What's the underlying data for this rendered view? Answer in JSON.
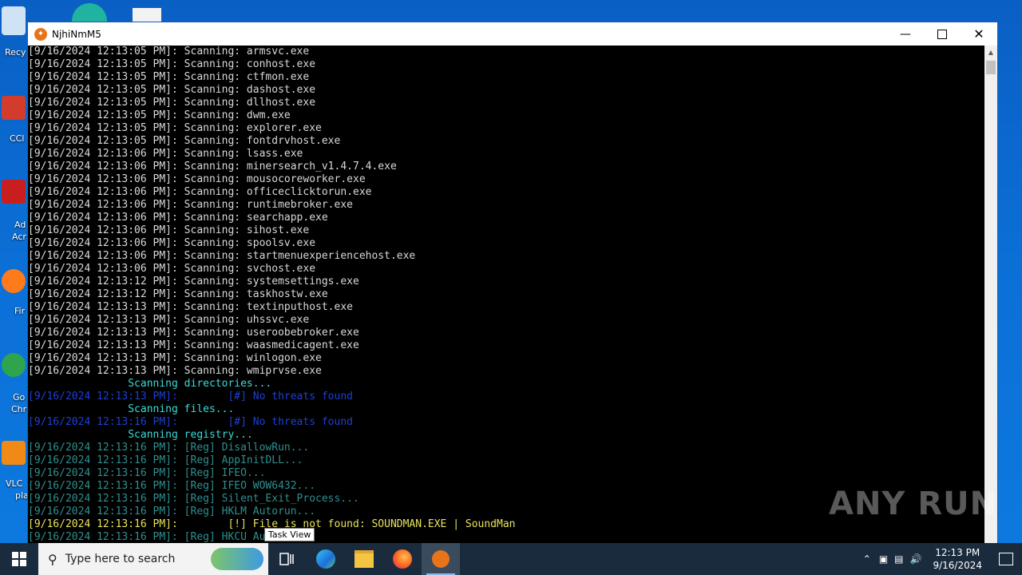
{
  "window": {
    "title": "NjhiNmM5"
  },
  "desktop": {
    "labels": [
      "Recy",
      "CCl",
      "Ad",
      "Acr",
      "Fir",
      "Go",
      "Chr",
      "VLC",
      "pla"
    ]
  },
  "console_lines": [
    {
      "color": "white",
      "text": "[9/16/2024 12:13:05 PM]: Scanning: armsvc.exe"
    },
    {
      "color": "white",
      "text": "[9/16/2024 12:13:05 PM]: Scanning: conhost.exe"
    },
    {
      "color": "white",
      "text": "[9/16/2024 12:13:05 PM]: Scanning: ctfmon.exe"
    },
    {
      "color": "white",
      "text": "[9/16/2024 12:13:05 PM]: Scanning: dashost.exe"
    },
    {
      "color": "white",
      "text": "[9/16/2024 12:13:05 PM]: Scanning: dllhost.exe"
    },
    {
      "color": "white",
      "text": "[9/16/2024 12:13:05 PM]: Scanning: dwm.exe"
    },
    {
      "color": "white",
      "text": "[9/16/2024 12:13:05 PM]: Scanning: explorer.exe"
    },
    {
      "color": "white",
      "text": "[9/16/2024 12:13:05 PM]: Scanning: fontdrvhost.exe"
    },
    {
      "color": "white",
      "text": "[9/16/2024 12:13:06 PM]: Scanning: lsass.exe"
    },
    {
      "color": "white",
      "text": "[9/16/2024 12:13:06 PM]: Scanning: minersearch_v1.4.7.4.exe"
    },
    {
      "color": "white",
      "text": "[9/16/2024 12:13:06 PM]: Scanning: mousocoreworker.exe"
    },
    {
      "color": "white",
      "text": "[9/16/2024 12:13:06 PM]: Scanning: officeclicktorun.exe"
    },
    {
      "color": "white",
      "text": "[9/16/2024 12:13:06 PM]: Scanning: runtimebroker.exe"
    },
    {
      "color": "white",
      "text": "[9/16/2024 12:13:06 PM]: Scanning: searchapp.exe"
    },
    {
      "color": "white",
      "text": "[9/16/2024 12:13:06 PM]: Scanning: sihost.exe"
    },
    {
      "color": "white",
      "text": "[9/16/2024 12:13:06 PM]: Scanning: spoolsv.exe"
    },
    {
      "color": "white",
      "text": "[9/16/2024 12:13:06 PM]: Scanning: startmenuexperiencehost.exe"
    },
    {
      "color": "white",
      "text": "[9/16/2024 12:13:06 PM]: Scanning: svchost.exe"
    },
    {
      "color": "white",
      "text": "[9/16/2024 12:13:12 PM]: Scanning: systemsettings.exe"
    },
    {
      "color": "white",
      "text": "[9/16/2024 12:13:12 PM]: Scanning: taskhostw.exe"
    },
    {
      "color": "white",
      "text": "[9/16/2024 12:13:13 PM]: Scanning: textinputhost.exe"
    },
    {
      "color": "white",
      "text": "[9/16/2024 12:13:13 PM]: Scanning: uhssvc.exe"
    },
    {
      "color": "white",
      "text": "[9/16/2024 12:13:13 PM]: Scanning: useroobebroker.exe"
    },
    {
      "color": "white",
      "text": "[9/16/2024 12:13:13 PM]: Scanning: waasmedicagent.exe"
    },
    {
      "color": "white",
      "text": "[9/16/2024 12:13:13 PM]: Scanning: winlogon.exe"
    },
    {
      "color": "white",
      "text": "[9/16/2024 12:13:13 PM]: Scanning: wmiprvse.exe"
    },
    {
      "color": "cyan",
      "text": "                Scanning directories..."
    },
    {
      "color": "blue",
      "text": "[9/16/2024 12:13:13 PM]:        [#] No threats found"
    },
    {
      "color": "cyan",
      "text": "                Scanning files..."
    },
    {
      "color": "blue",
      "text": "[9/16/2024 12:13:16 PM]:        [#] No threats found"
    },
    {
      "color": "cyan",
      "text": "                Scanning registry..."
    },
    {
      "color": "teal",
      "text": "[9/16/2024 12:13:16 PM]: [Reg] DisallowRun..."
    },
    {
      "color": "teal",
      "text": "[9/16/2024 12:13:16 PM]: [Reg] AppInitDLL..."
    },
    {
      "color": "teal",
      "text": "[9/16/2024 12:13:16 PM]: [Reg] IFEO..."
    },
    {
      "color": "teal",
      "text": "[9/16/2024 12:13:16 PM]: [Reg] IFEO WOW6432..."
    },
    {
      "color": "teal",
      "text": "[9/16/2024 12:13:16 PM]: [Reg] Silent_Exit_Process..."
    },
    {
      "color": "teal",
      "text": "[9/16/2024 12:13:16 PM]: [Reg] HKLM Autorun..."
    },
    {
      "color": "yellow",
      "text": "[9/16/2024 12:13:16 PM]:        [!] File is not found: SOUNDMAN.EXE | SoundMan"
    },
    {
      "color": "teal",
      "text": "[9/16/2024 12:13:16 PM]: [Reg] HKCU Autorun..."
    }
  ],
  "watermark": "ANY RUN",
  "tooltip": "Task View",
  "taskbar": {
    "search_placeholder": "Type here to search",
    "time": "12:13 PM",
    "date": "9/16/2024"
  }
}
